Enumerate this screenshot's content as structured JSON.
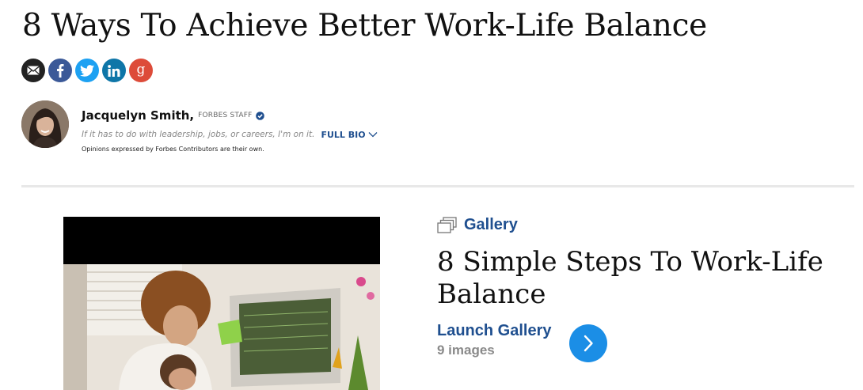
{
  "article": {
    "headline": "8 Ways To Achieve Better Work-Life Balance"
  },
  "share": {
    "icons": [
      "email-icon",
      "facebook-icon",
      "twitter-icon",
      "linkedin-icon",
      "google-plus-icon"
    ],
    "colors": {
      "email": "#222222",
      "facebook": "#3b5998",
      "twitter": "#1da1f2",
      "linkedin": "#0e76a8",
      "google_plus": "#dd4b39"
    }
  },
  "author": {
    "name": "Jacquelyn Smith,",
    "staff_label": "FORBES STAFF",
    "tagline": "If it has to do with leadership, jobs, or careers, I'm on it.",
    "full_bio_label": "FULL BIO",
    "disclaimer": "Opinions expressed by Forbes Contributors are their own."
  },
  "gallery": {
    "label": "Gallery",
    "title": "8 Simple Steps To Work-Life Balance",
    "launch_label": "Launch Gallery",
    "count_text": "9 images"
  },
  "colors": {
    "link_blue": "#1f4f8f",
    "launch_blue": "#1b8ee6",
    "divider": "#e8e8e8"
  }
}
